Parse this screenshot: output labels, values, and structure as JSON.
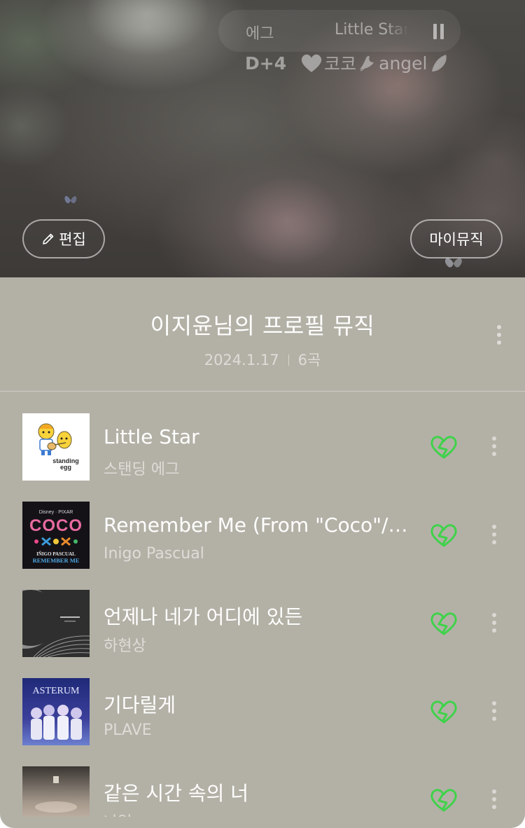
{
  "now_playing": {
    "artist": "에그",
    "title": "Little Star",
    "pause_icon": "pause-icon"
  },
  "status": {
    "dday": "D+4",
    "name": "코코",
    "tag": "angel"
  },
  "buttons": {
    "edit": "편집",
    "my_music": "마이뮤직"
  },
  "playlist": {
    "title": "이지윤님의 프로필 뮤직",
    "date": "2024.1.17",
    "count": "6곡"
  },
  "tracks": [
    {
      "title": "Little Star",
      "artist": "스탠딩 에그",
      "liked": true
    },
    {
      "title": "Remember Me (From \"Coco\"/…",
      "artist": "Inigo Pascual",
      "liked": true
    },
    {
      "title": "언제나 네가 어디에 있든",
      "artist": "하현상",
      "liked": true
    },
    {
      "title": "기다릴게",
      "artist": "PLAVE",
      "liked": true
    },
    {
      "title": "같은 시간 속의 너",
      "artist": "나얼",
      "liked": true
    }
  ],
  "album_art": {
    "track1": {
      "logo_top": "standing",
      "logo_bottom": "egg"
    },
    "track2": {
      "brand": "Disney · PIXAR",
      "title": "COCO",
      "artist": "IÑIGO PASCUAL",
      "song": "REMEMBER ME"
    },
    "track4": {
      "title": "ASTERUM"
    }
  },
  "colors": {
    "panel_bg": "#b3b1a6",
    "like_green": "#3fd24a",
    "text_primary": "#ffffff"
  }
}
